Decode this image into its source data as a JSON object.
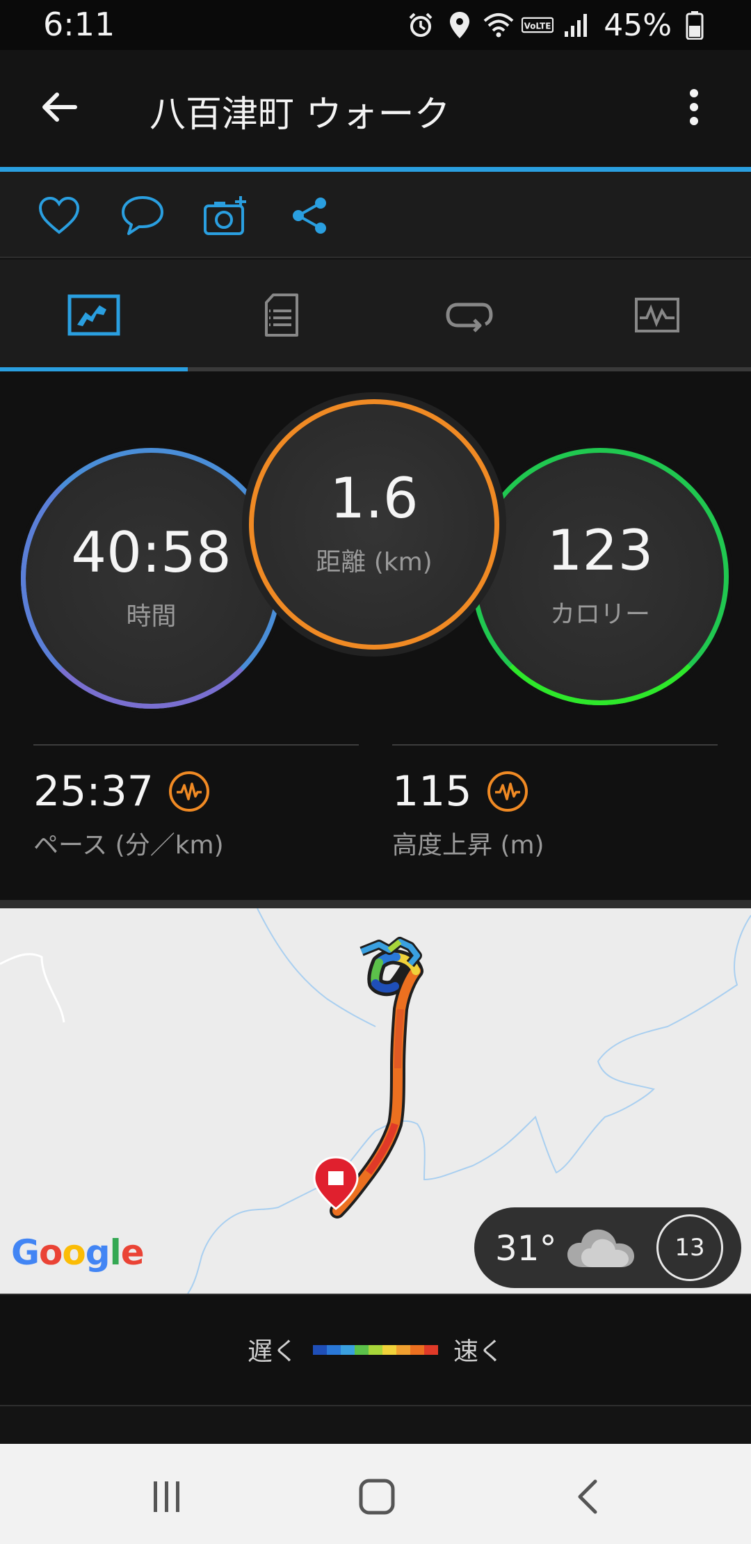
{
  "status_bar": {
    "time": "6:11",
    "battery": "45%",
    "icons": [
      "alarm-icon",
      "location-icon",
      "wifi-icon",
      "volte-icon",
      "signal-icon",
      "battery-icon"
    ]
  },
  "app_bar": {
    "title": "八百津町 ウォーク",
    "back_icon": "arrow-left-icon",
    "more_icon": "more-vertical-icon"
  },
  "actions": [
    "heart-icon",
    "comment-icon",
    "add-photo-icon",
    "share-icon"
  ],
  "tabs": [
    {
      "icon": "overview-chart-icon",
      "active": true
    },
    {
      "icon": "details-list-icon",
      "active": false
    },
    {
      "icon": "laps-loop-icon",
      "active": false
    },
    {
      "icon": "graph-icon",
      "active": false
    }
  ],
  "stats": {
    "time": {
      "value": "40:58",
      "label": "時間"
    },
    "distance": {
      "value": "1.6",
      "label": "距離 (km)"
    },
    "calories": {
      "value": "123",
      "label": "カロリー"
    }
  },
  "metrics": {
    "pace": {
      "value": "25:37",
      "label": "ペース (分／km)"
    },
    "elevation": {
      "value": "115",
      "label": "高度上昇 (m)"
    }
  },
  "map": {
    "attribution": "Google",
    "weather": {
      "temperature": "31°",
      "condition_icon": "cloud-icon",
      "wind": "13"
    }
  },
  "legend": {
    "slow": "遅く",
    "fast": "速く",
    "colors": [
      "#1f4fb8",
      "#2a78d8",
      "#3aa0e0",
      "#5cc14a",
      "#a8d63a",
      "#f0d23a",
      "#f0a030",
      "#ec7020",
      "#e03a28"
    ]
  },
  "nav_bar": [
    "recents-icon",
    "home-icon",
    "back-icon"
  ]
}
